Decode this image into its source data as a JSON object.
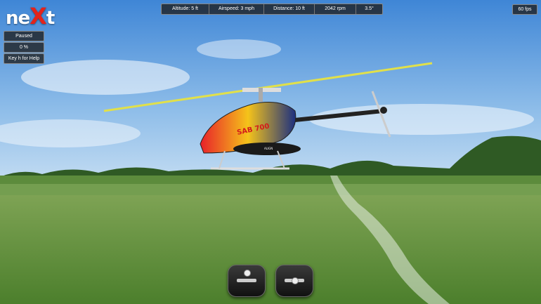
{
  "logo": {
    "prefix": "ne",
    "x": "X",
    "suffix": "t"
  },
  "telemetry": [
    {
      "id": "altitude",
      "text": "Altitude: 5 ft"
    },
    {
      "id": "airspeed",
      "text": "Airspeed: 3 mph"
    },
    {
      "id": "distance",
      "text": "Distance: 10 ft"
    },
    {
      "id": "rpm",
      "text": "2042 rpm"
    },
    {
      "id": "angle",
      "text": "3.5°"
    }
  ],
  "fps": "60 fps",
  "side_buttons": {
    "paused": "Paused",
    "percent": "0 %",
    "help": "Key h for Help"
  },
  "helicopter": {
    "decal": "SAB 700",
    "brand": "ALIGN"
  },
  "colors": {
    "sky_top": "#3f86d6",
    "sky_bottom": "#c3dcf2",
    "grass": "#5f8f3a",
    "logo_x": "#e4231b"
  },
  "icons": [
    "left-stick-icon",
    "right-stick-icon"
  ]
}
